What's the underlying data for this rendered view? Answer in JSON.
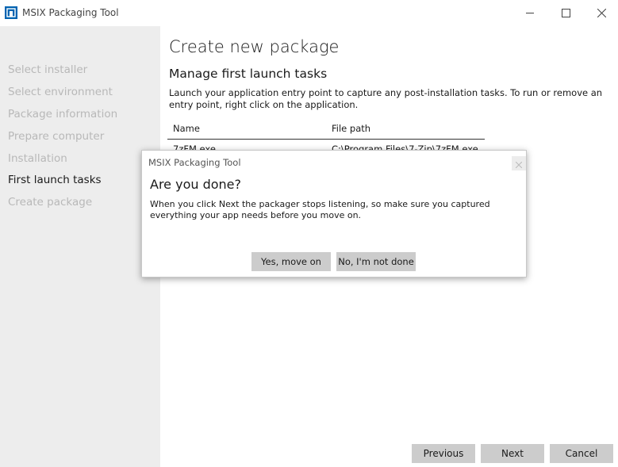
{
  "window": {
    "title": "MSIX Packaging Tool",
    "icon": "msix-app-icon",
    "controls": [
      "minimize-icon",
      "maximize-icon",
      "close-icon"
    ]
  },
  "sidebar": {
    "items": [
      {
        "label": "Select installer",
        "active": false
      },
      {
        "label": "Select environment",
        "active": false
      },
      {
        "label": "Package information",
        "active": false
      },
      {
        "label": "Prepare computer",
        "active": false
      },
      {
        "label": "Installation",
        "active": false
      },
      {
        "label": "First launch tasks",
        "active": true
      },
      {
        "label": "Create package",
        "active": false
      }
    ]
  },
  "main": {
    "page_title": "Create new package",
    "section_title": "Manage first launch tasks",
    "description": "Launch your application entry point to capture any post-installation tasks. To run or remove an entry point, right click on the application.",
    "table": {
      "columns": [
        "Name",
        "File path"
      ],
      "rows": [
        {
          "name": "7zFM.exe",
          "path": "C:\\Program Files\\7-Zip\\7zFM.exe"
        }
      ]
    }
  },
  "footer": {
    "previous": "Previous",
    "next": "Next",
    "cancel": "Cancel"
  },
  "dialog": {
    "title": "MSIX Packaging Tool",
    "heading": "Are you done?",
    "body": "When you click Next the packager stops listening, so make sure you captured everything your app needs before you move on.",
    "yes": "Yes, move on",
    "no": "No, I'm not done"
  },
  "colors": {
    "sidebar_bg": "#ededed",
    "button_bg": "#cccccc",
    "inactive_nav": "#b8b8b8",
    "accent": "#0063b1"
  }
}
